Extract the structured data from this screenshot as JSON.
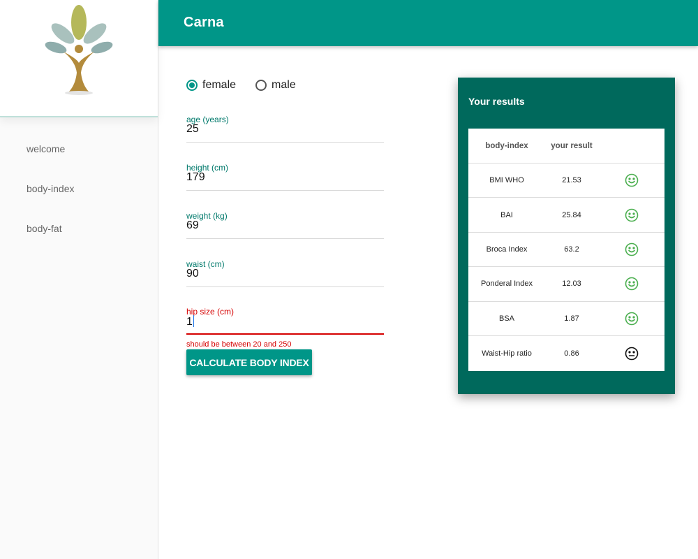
{
  "app": {
    "title": "Carna"
  },
  "sidebar": {
    "items": [
      {
        "label": "welcome"
      },
      {
        "label": "body-index"
      },
      {
        "label": "body-fat"
      }
    ]
  },
  "form": {
    "gender": {
      "options": [
        {
          "label": "female",
          "checked": true
        },
        {
          "label": "male",
          "checked": false
        }
      ]
    },
    "fields": {
      "age": {
        "label": "age (years)",
        "value": "25"
      },
      "height": {
        "label": "height (cm)",
        "value": "179"
      },
      "weight": {
        "label": "weight (kg)",
        "value": "69"
      },
      "waist": {
        "label": "waist (cm)",
        "value": "90"
      },
      "hip": {
        "label": "hip size (cm)",
        "value": "1",
        "error": "should be between 20 and 250"
      }
    },
    "calculate_label": "CALCULATE BODY INDEX"
  },
  "results": {
    "title": "Your results",
    "columns": [
      "body-index",
      "your result"
    ],
    "rows": [
      {
        "name": "BMI WHO",
        "value": "21.53",
        "status": "happy"
      },
      {
        "name": "BAI",
        "value": "25.84",
        "status": "happy"
      },
      {
        "name": "Broca Index",
        "value": "63.2",
        "status": "happy"
      },
      {
        "name": "Ponderal Index",
        "value": "12.03",
        "status": "happy"
      },
      {
        "name": "BSA",
        "value": "1.87",
        "status": "happy"
      },
      {
        "name": "Waist-Hip ratio",
        "value": "0.86",
        "status": "neutral"
      }
    ]
  },
  "colors": {
    "primary": "#009688",
    "primary_dark": "#00695c",
    "error": "#d50000",
    "happy": "#4caf50",
    "neutral": "#111111"
  }
}
